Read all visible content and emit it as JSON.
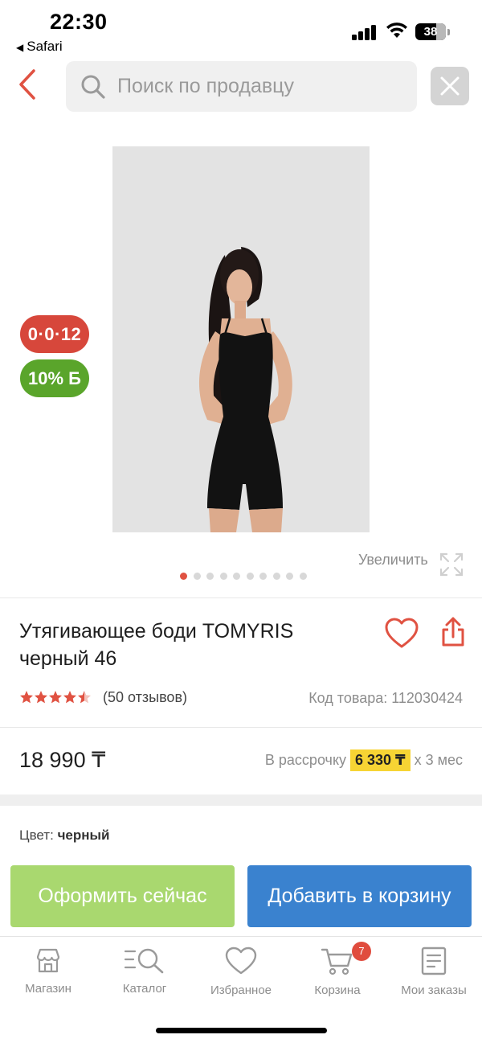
{
  "status_bar": {
    "time": "22:30",
    "back_app": "Safari",
    "battery": "38"
  },
  "search": {
    "placeholder": "Поиск по продавцу"
  },
  "product": {
    "badge_installment": "0·0·12",
    "badge_bonus": "10% Б",
    "zoom_label": "Увеличить",
    "image_count": 10,
    "active_image_index": 0,
    "title": "Утягивающее боди TOMYRIS черный 46",
    "rating": 4.5,
    "reviews": "(50 отзывов)",
    "sku": "Код товара: 112030424",
    "price": "18 990 ₸",
    "installment_prefix": "В рассрочку",
    "installment_amount": "6 330 ₸",
    "installment_suffix": "x 3 мес",
    "color_label": "Цвет:",
    "color_value": "черный"
  },
  "actions": {
    "buy_now": "Оформить сейчас",
    "add_to_cart": "Добавить в корзину"
  },
  "tabbar": {
    "items": [
      {
        "label": "Магазин",
        "icon": "shop-icon"
      },
      {
        "label": "Каталог",
        "icon": "catalog-search-icon"
      },
      {
        "label": "Избранное",
        "icon": "heart-icon"
      },
      {
        "label": "Корзина",
        "icon": "cart-icon"
      },
      {
        "label": "Мои заказы",
        "icon": "orders-icon"
      }
    ],
    "cart_count": "7"
  },
  "colors": {
    "accent_red": "#e05242",
    "bonus_green": "#5aa52b",
    "buy_green": "#a9d86f",
    "cart_blue": "#3a82cf",
    "installment_yellow": "#f7d434"
  }
}
